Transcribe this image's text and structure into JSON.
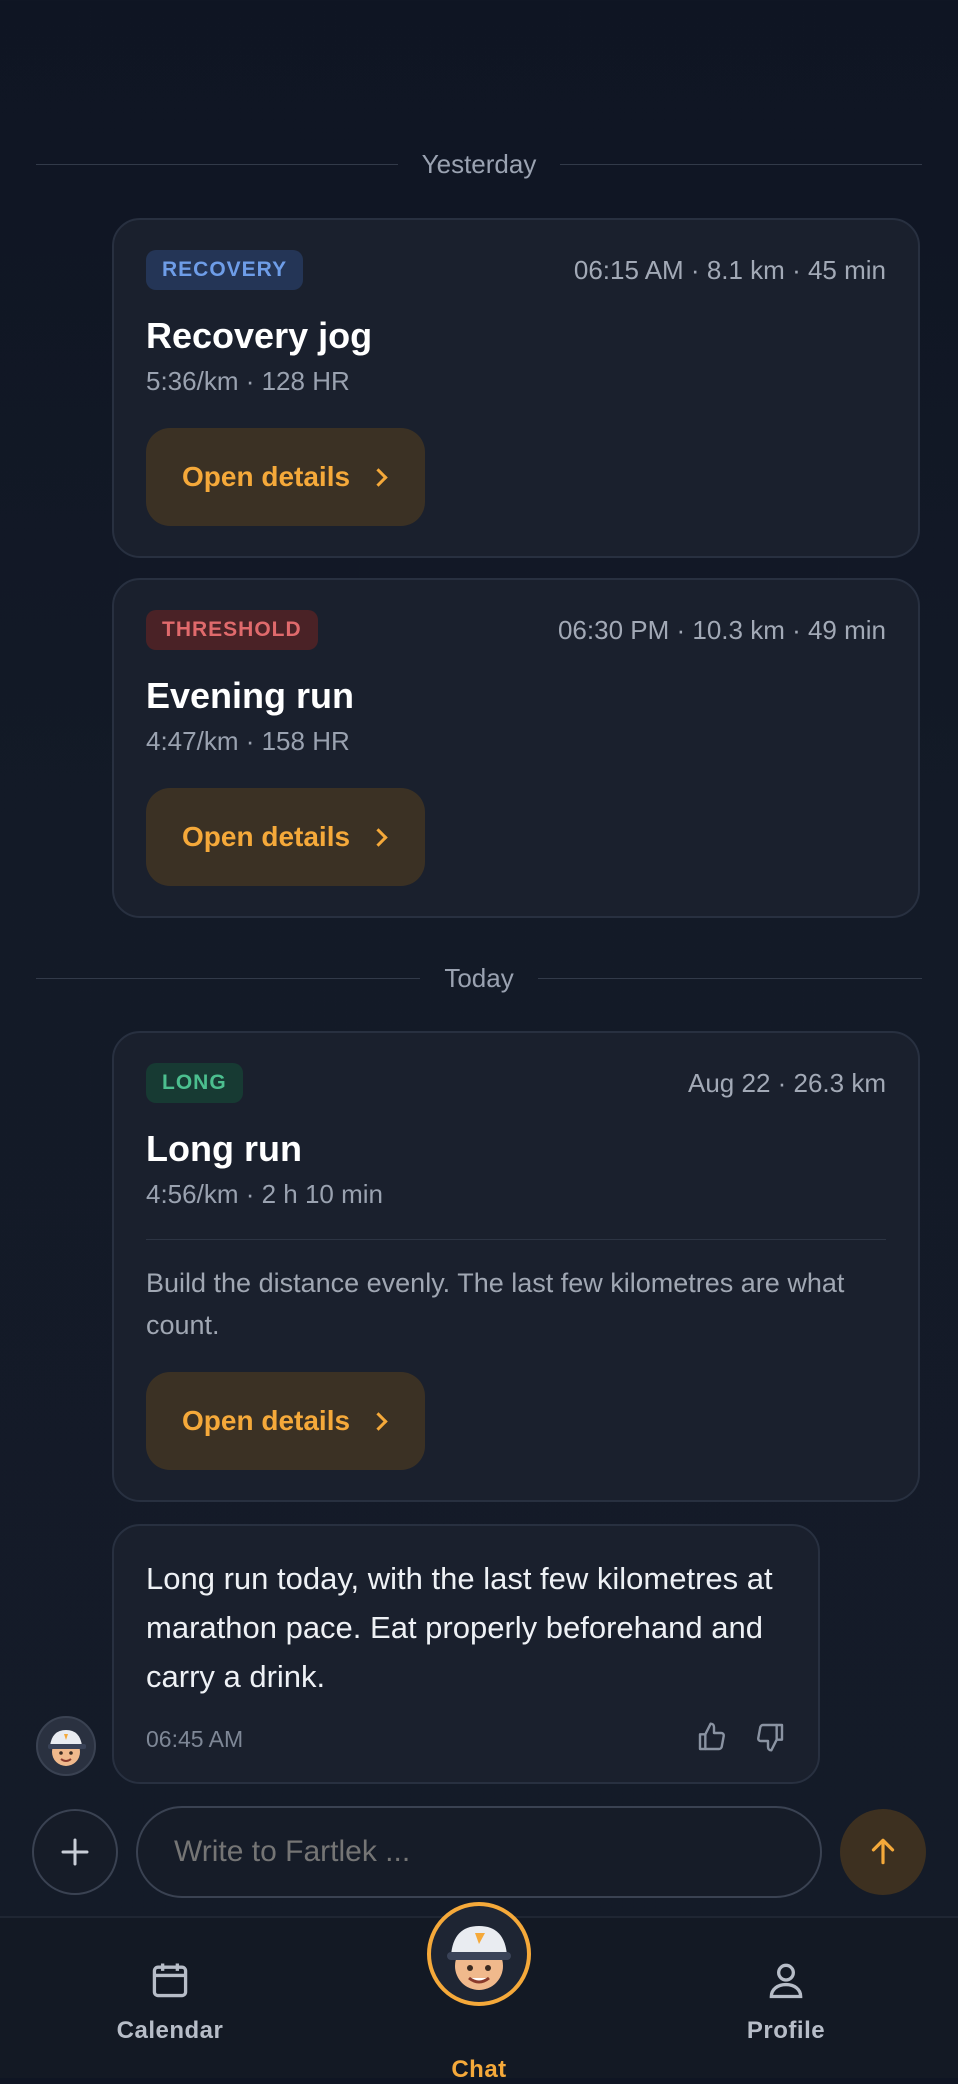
{
  "timeline": {
    "yesterday_label": "Yesterday",
    "today_label": "Today"
  },
  "workouts": [
    {
      "badge": "RECOVERY",
      "meta": "06:15 AM · 8.1 km · 45 min",
      "title": "Recovery jog",
      "sub": "5:36/km · 128 HR",
      "button": "Open details"
    },
    {
      "badge": "THRESHOLD",
      "meta": "06:30 PM · 10.3 km · 49 min",
      "title": "Evening run",
      "sub": "4:47/km · 158 HR",
      "button": "Open details"
    },
    {
      "badge": "LONG",
      "meta": "Aug 22 · 26.3 km",
      "title": "Long run",
      "sub": "4:56/km · 2 h 10 min",
      "description": "Build the distance evenly. The last few kilometres are what count.",
      "button": "Open details"
    }
  ],
  "message": {
    "text": "Long run today, with the last few kilometres at marathon pace. Eat properly beforehand and carry a drink.",
    "time": "06:45 AM"
  },
  "composer": {
    "placeholder": "Write to Fartlek ..."
  },
  "tabs": [
    {
      "label": "Calendar",
      "icon": "calendar-icon"
    },
    {
      "label": "Chat",
      "icon": "coach-avatar",
      "active": true
    },
    {
      "label": "Profile",
      "icon": "person-icon"
    }
  ],
  "colors": {
    "accent": "#f5a93a",
    "recovery": "#6e9de8",
    "threshold": "#e06a6c",
    "long": "#4cbf8f"
  }
}
